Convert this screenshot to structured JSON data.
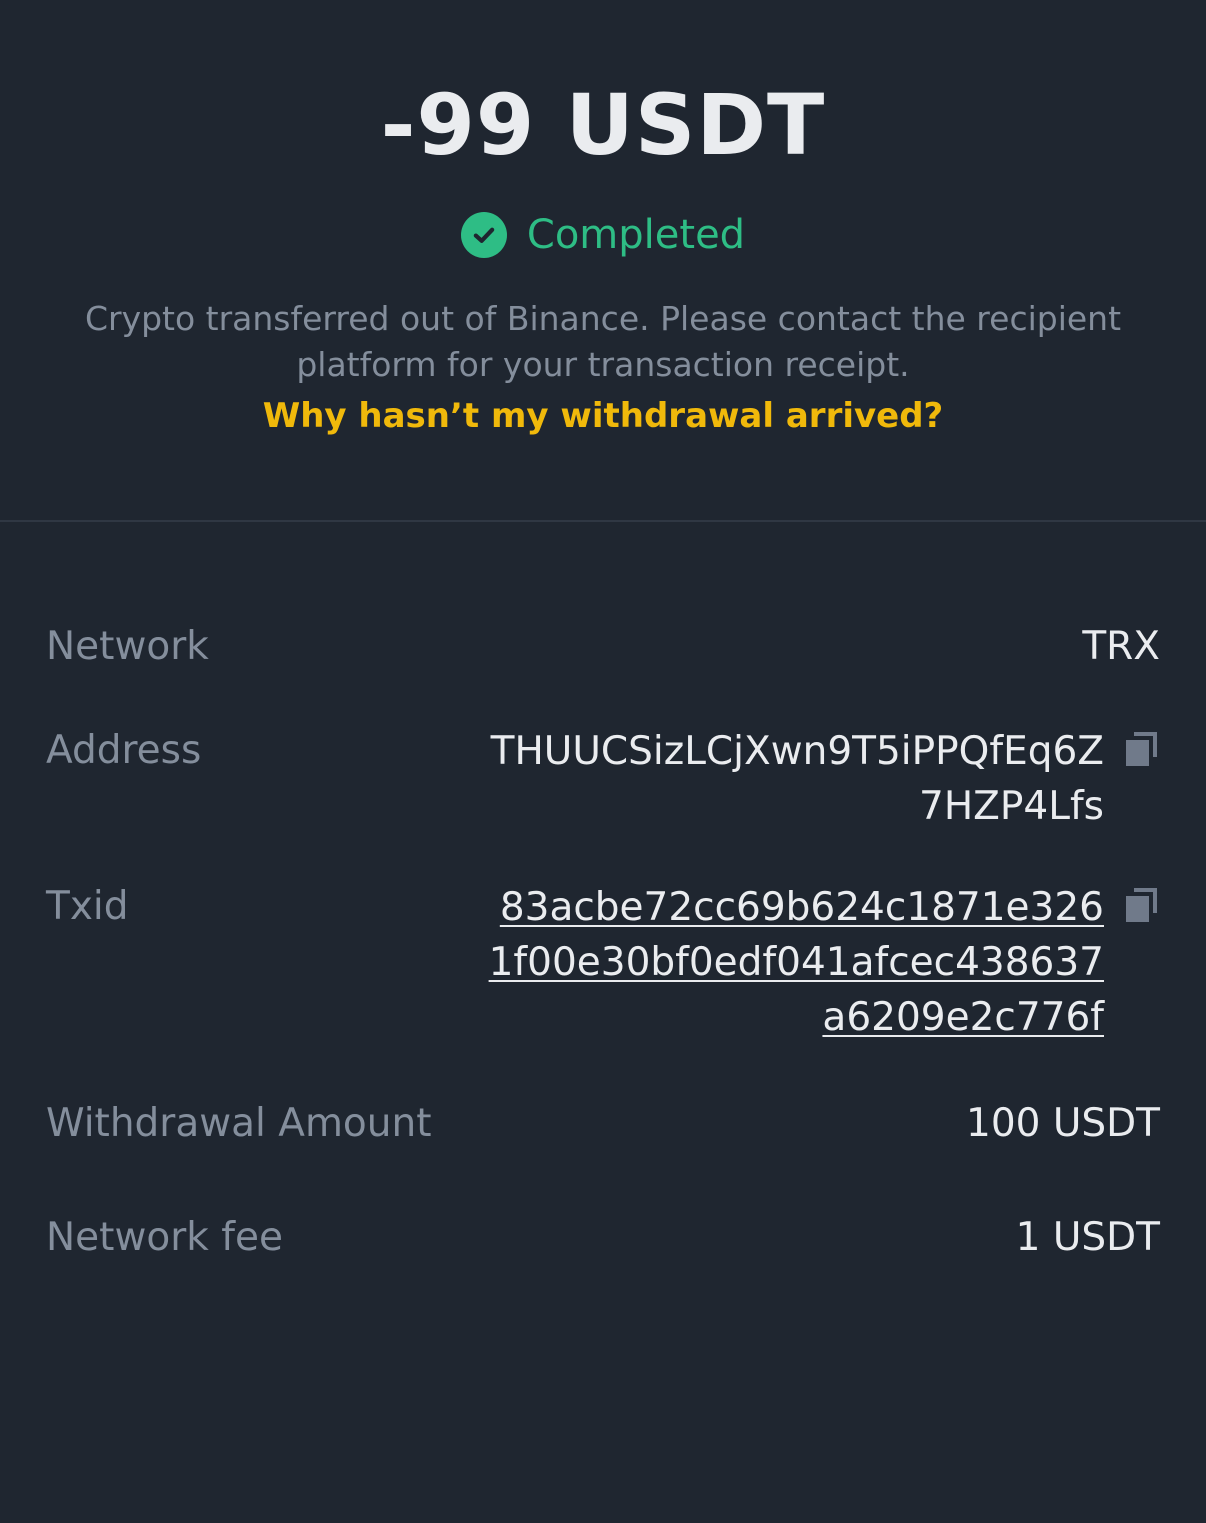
{
  "header": {
    "amount": "-99 USDT",
    "status": "Completed",
    "description": "Crypto transferred out of Binance. Please contact the recipient platform for your transaction receipt.",
    "faq_link": "Why hasn’t my withdrawal arrived?"
  },
  "details": {
    "network": {
      "label": "Network",
      "value": "TRX"
    },
    "address": {
      "label": "Address",
      "value": "THUUCSizLCjXwn9T5iPPQfEq6Z7HZP4Lfs"
    },
    "txid": {
      "label": "Txid",
      "value": "83acbe72cc69b624c1871e3261f00e30bf0edf041afcec438637a6209e2c776f"
    },
    "withdrawal_amount": {
      "label": "Withdrawal Amount",
      "value": "100 USDT"
    },
    "network_fee": {
      "label": "Network fee",
      "value": "1 USDT"
    }
  },
  "colors": {
    "background": "#1f2630",
    "success": "#2ebd85",
    "link": "#f0b90b",
    "label": "#848e9c",
    "text": "#eaecef"
  },
  "icons": {
    "status": "check-circle-icon",
    "copy": "copy-icon"
  }
}
